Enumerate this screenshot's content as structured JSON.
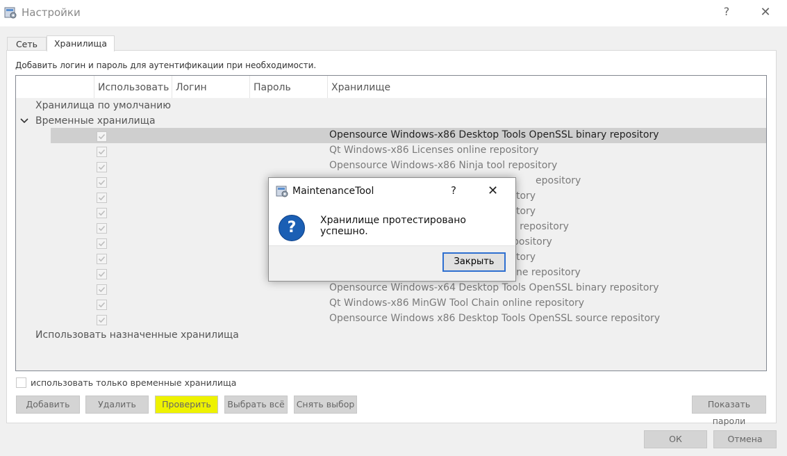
{
  "window": {
    "title": "Настройки",
    "help_glyph": "?",
    "close_glyph": "✕"
  },
  "tabs": [
    {
      "label": "Сеть"
    },
    {
      "label": "Хранилища"
    }
  ],
  "hint": "Добавить логин и пароль для аутентификации при необходимости.",
  "tree": {
    "columns": [
      "Использовать",
      "Логин",
      "Пароль",
      "Хранилище"
    ],
    "default_group": "Хранилища по умолчанию",
    "temp_group": "Временные хранилища",
    "assigned_group": "Использовать назначенные хранилища",
    "repos": [
      {
        "name": "Opensource Windows-x86 Desktop Tools OpenSSL binary repository"
      },
      {
        "name": "Qt Windows-x86 Licenses online repository"
      },
      {
        "name": "Opensource Windows-x86 Ninja tool repository"
      },
      {
        "name": "epository"
      },
      {
        "name": "tory"
      },
      {
        "name": "tory"
      },
      {
        "name": "e repository"
      },
      {
        "name": "pository"
      },
      {
        "name": "tory"
      },
      {
        "name": "ne repository"
      },
      {
        "name": "Opensource Windows-x64 Desktop Tools OpenSSL binary repository"
      },
      {
        "name": "Qt Windows-x86 MinGW Tool Chain online repository"
      },
      {
        "name": "Opensource Windows x86 Desktop Tools OpenSSL source repository"
      }
    ]
  },
  "only_temp_label": "использовать только временные хранилища",
  "buttons": {
    "add": "Добавить",
    "remove": "Удалить",
    "test": "Проверить",
    "select_all": "Выбрать всё",
    "deselect": "Снять выбор",
    "show_passwords": "Показать пароли",
    "ok": "ОК",
    "cancel": "Отмена"
  },
  "modal": {
    "title": "MaintenanceTool",
    "help_glyph": "?",
    "close_glyph": "✕",
    "icon_glyph": "?",
    "message": "Хранилище протестировано успешно.",
    "close_button": "Закрыть"
  }
}
